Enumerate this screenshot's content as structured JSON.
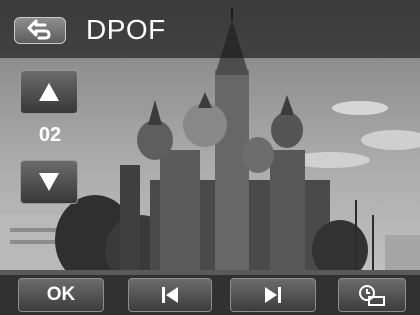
{
  "header": {
    "title": "DPOF",
    "back_icon": "back-arrow-icon"
  },
  "side": {
    "up_icon": "triangle-up-icon",
    "count": "02",
    "down_icon": "triangle-down-icon"
  },
  "bottom": {
    "ok_label": "OK",
    "prev_icon": "skip-previous-icon",
    "next_icon": "skip-next-icon",
    "date_icon": "date-stamp-icon"
  },
  "colors": {
    "bar": "#141414",
    "button": "#5a5a5a",
    "text": "#ffffff"
  }
}
